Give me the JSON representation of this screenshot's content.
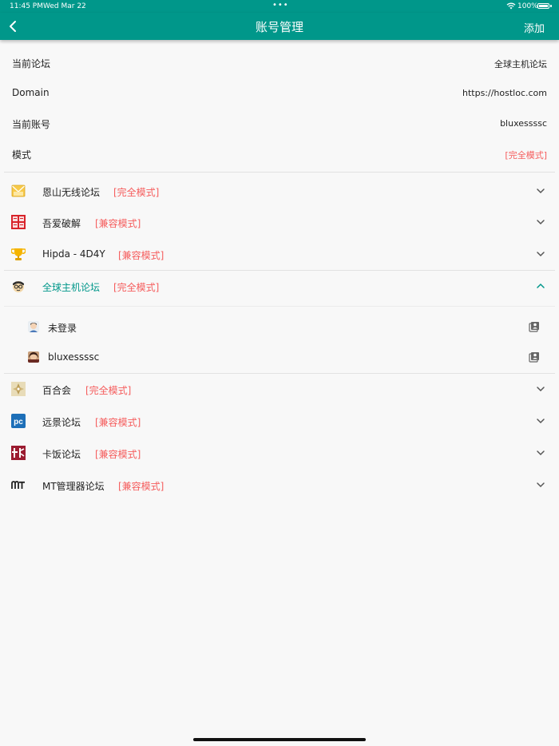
{
  "status_bar": {
    "time": "11:45 PM",
    "date": "Wed Mar 22",
    "dots": "•••",
    "battery": "100%"
  },
  "navbar": {
    "title": "账号管理",
    "add_label": "添加",
    "color": "#00978a"
  },
  "info": {
    "current_forum_label": "当前论坛",
    "current_forum_value": "全球主机论坛",
    "domain_label": "Domain",
    "domain_value": "https://hostloc.com",
    "current_account_label": "当前账号",
    "current_account_value": "bluxessssc",
    "mode_label": "模式",
    "mode_value": "[完全模式]"
  },
  "forums": [
    {
      "name": "恩山无线论坛",
      "mode": "[完全模式]",
      "icon": "envelope-icon",
      "expanded": false
    },
    {
      "name": "吾爱破解",
      "mode": "[兼容模式]",
      "icon": "52pojie-logo-icon",
      "expanded": false
    },
    {
      "name": "Hipda - 4D4Y",
      "mode": "[兼容模式]",
      "icon": "trophy-icon",
      "expanded": false
    },
    {
      "name": "全球主机论坛",
      "mode": "[完全模式]",
      "icon": "hostloc-avatar-icon",
      "expanded": true
    },
    {
      "name": "百合会",
      "mode": "[完全模式]",
      "icon": "yamibo-logo-icon",
      "expanded": false
    },
    {
      "name": "远景论坛",
      "mode": "[兼容模式]",
      "icon": "pcbeta-logo-icon",
      "expanded": false
    },
    {
      "name": "卡饭论坛",
      "mode": "[兼容模式]",
      "icon": "kafan-logo-icon",
      "expanded": false
    },
    {
      "name": "MT管理器论坛",
      "mode": "[兼容模式]",
      "icon": "mt-logo-icon",
      "expanded": false
    }
  ],
  "accounts": [
    {
      "name": "未登录",
      "avatar": "default-avatar-icon"
    },
    {
      "name": "bluxessssc",
      "avatar": "user-avatar-icon"
    }
  ],
  "colors": {
    "accent": "#00978a",
    "mode_red": "#f55c5c",
    "background": "#f8f8f8",
    "divider": "#e2e2e2"
  }
}
